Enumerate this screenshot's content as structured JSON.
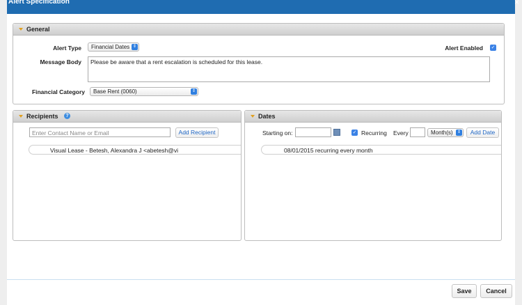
{
  "dialog": {
    "title": "Alert Specification",
    "close_icon": "close-icon"
  },
  "general": {
    "header": "General",
    "alert_type_label": "Alert Type",
    "alert_type_value": "Financial Dates",
    "alert_enabled_label": "Alert Enabled",
    "alert_enabled_checked": true,
    "message_body_label": "Message Body",
    "message_body_value": "Please be aware that a rent escalation is scheduled for this lease.",
    "financial_category_label": "Financial Category",
    "financial_category_value": "Base Rent (0060)"
  },
  "recipients": {
    "header": "Recipients",
    "help_icon": "help-icon",
    "contact_placeholder": "Enter Contact Name or Email",
    "add_button": "Add Recipient",
    "items": [
      {
        "label": "Visual Lease - Betesh, Alexandra J <abetesh@vi"
      }
    ]
  },
  "dates": {
    "header": "Dates",
    "starting_on_label": "Starting on:",
    "starting_on_value": "",
    "calendar_icon": "calendar-icon",
    "recurring_label": "Recurring",
    "recurring_checked": true,
    "every_label": "Every",
    "every_value": "",
    "period_value": "Month(s)",
    "add_button": "Add Date",
    "items": [
      {
        "label": "08/01/2015 recurring every month"
      }
    ]
  },
  "footer": {
    "save": "Save",
    "cancel": "Cancel"
  },
  "colors": {
    "titlebar": "#1f6cb1",
    "accent_arrow": "#e0a020",
    "link_blue": "#1f66c4"
  }
}
